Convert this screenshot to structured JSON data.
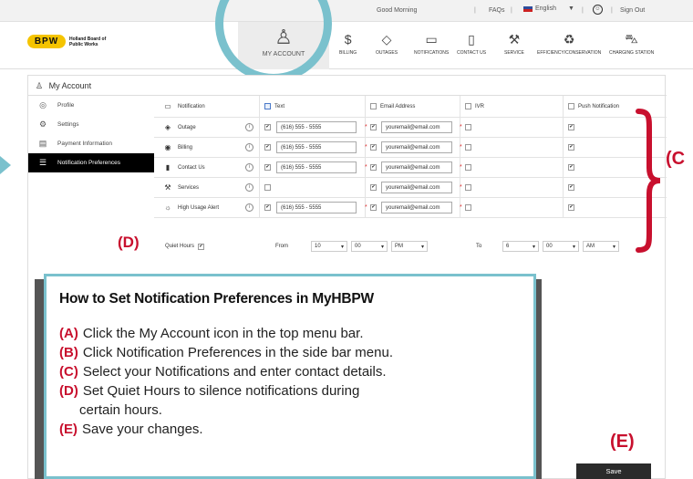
{
  "topbar": {
    "greeting": "Good Morning",
    "faqs": "FAQs",
    "language": "English",
    "sign_out": "Sign Out"
  },
  "logo": {
    "mark": "BPW",
    "line1": "Holland Board of",
    "line2": "Public Works"
  },
  "nav": {
    "my_account": "MY ACCOUNT",
    "billing": "BILLING",
    "outages": "OUTAGES",
    "notifications": "NOTIFICATIONS",
    "contact_us": "CONTACT US",
    "service": "SERVICE",
    "efficiency": "EFFICIENCY/CONSERVATION",
    "charging": "CHARGING STATION"
  },
  "account_title": "My Account",
  "sidebar": {
    "items": [
      {
        "label": "Profile",
        "icon": "person-circle-icon"
      },
      {
        "label": "Settings",
        "icon": "gears-icon"
      },
      {
        "label": "Payment Information",
        "icon": "credit-card-icon"
      },
      {
        "label": "Notification Preferences",
        "icon": "chat-list-icon",
        "active": true
      }
    ]
  },
  "table": {
    "headers": {
      "notification": "Notification",
      "text": "Text",
      "email": "Email Address",
      "ivr": "IVR",
      "push": "Push Notification"
    },
    "rows": [
      {
        "name": "Outage",
        "phone": "(616) 555 - 5555",
        "email": "youremail@email.com"
      },
      {
        "name": "Billing",
        "phone": "(616) 555 - 5555",
        "email": "youremail@email.com"
      },
      {
        "name": "Contact Us",
        "phone": "(616) 555 - 5555",
        "email": "youremail@email.com"
      },
      {
        "name": "Services",
        "phone": "",
        "email": "youremail@email.com"
      },
      {
        "name": "High Usage Alert",
        "phone": "(616) 555 - 5555",
        "email": "youremail@email.com"
      }
    ]
  },
  "quiet_hours": {
    "label": "Quiet Hours",
    "from_label": "From",
    "from_hour": "10",
    "from_min": "00",
    "from_ampm": "PM",
    "to_label": "To",
    "to_hour": "6",
    "to_min": "00",
    "to_ampm": "AM"
  },
  "callouts": {
    "c": "(C",
    "d": "(D)",
    "e": "(E)"
  },
  "instructions": {
    "title": "How to Set Notification Preferences in MyHBPW",
    "steps": [
      {
        "tag": "(A)",
        "text": "Click the My Account icon in the top menu bar."
      },
      {
        "tag": "(B)",
        "text": "Click Notification Preferences in the side bar menu."
      },
      {
        "tag": "(C)",
        "text": "Select your Notifications and enter contact details."
      },
      {
        "tag": "(D)",
        "text": "Set Quiet Hours to silence notifications during"
      },
      {
        "tag": "",
        "text": "certain hours."
      },
      {
        "tag": "(E)",
        "text": "Save your changes."
      }
    ]
  },
  "save_label": "Save",
  "colors": {
    "accent_teal": "#7ac1cd",
    "callout_red": "#c8102e",
    "logo_yellow": "#f5c400"
  }
}
